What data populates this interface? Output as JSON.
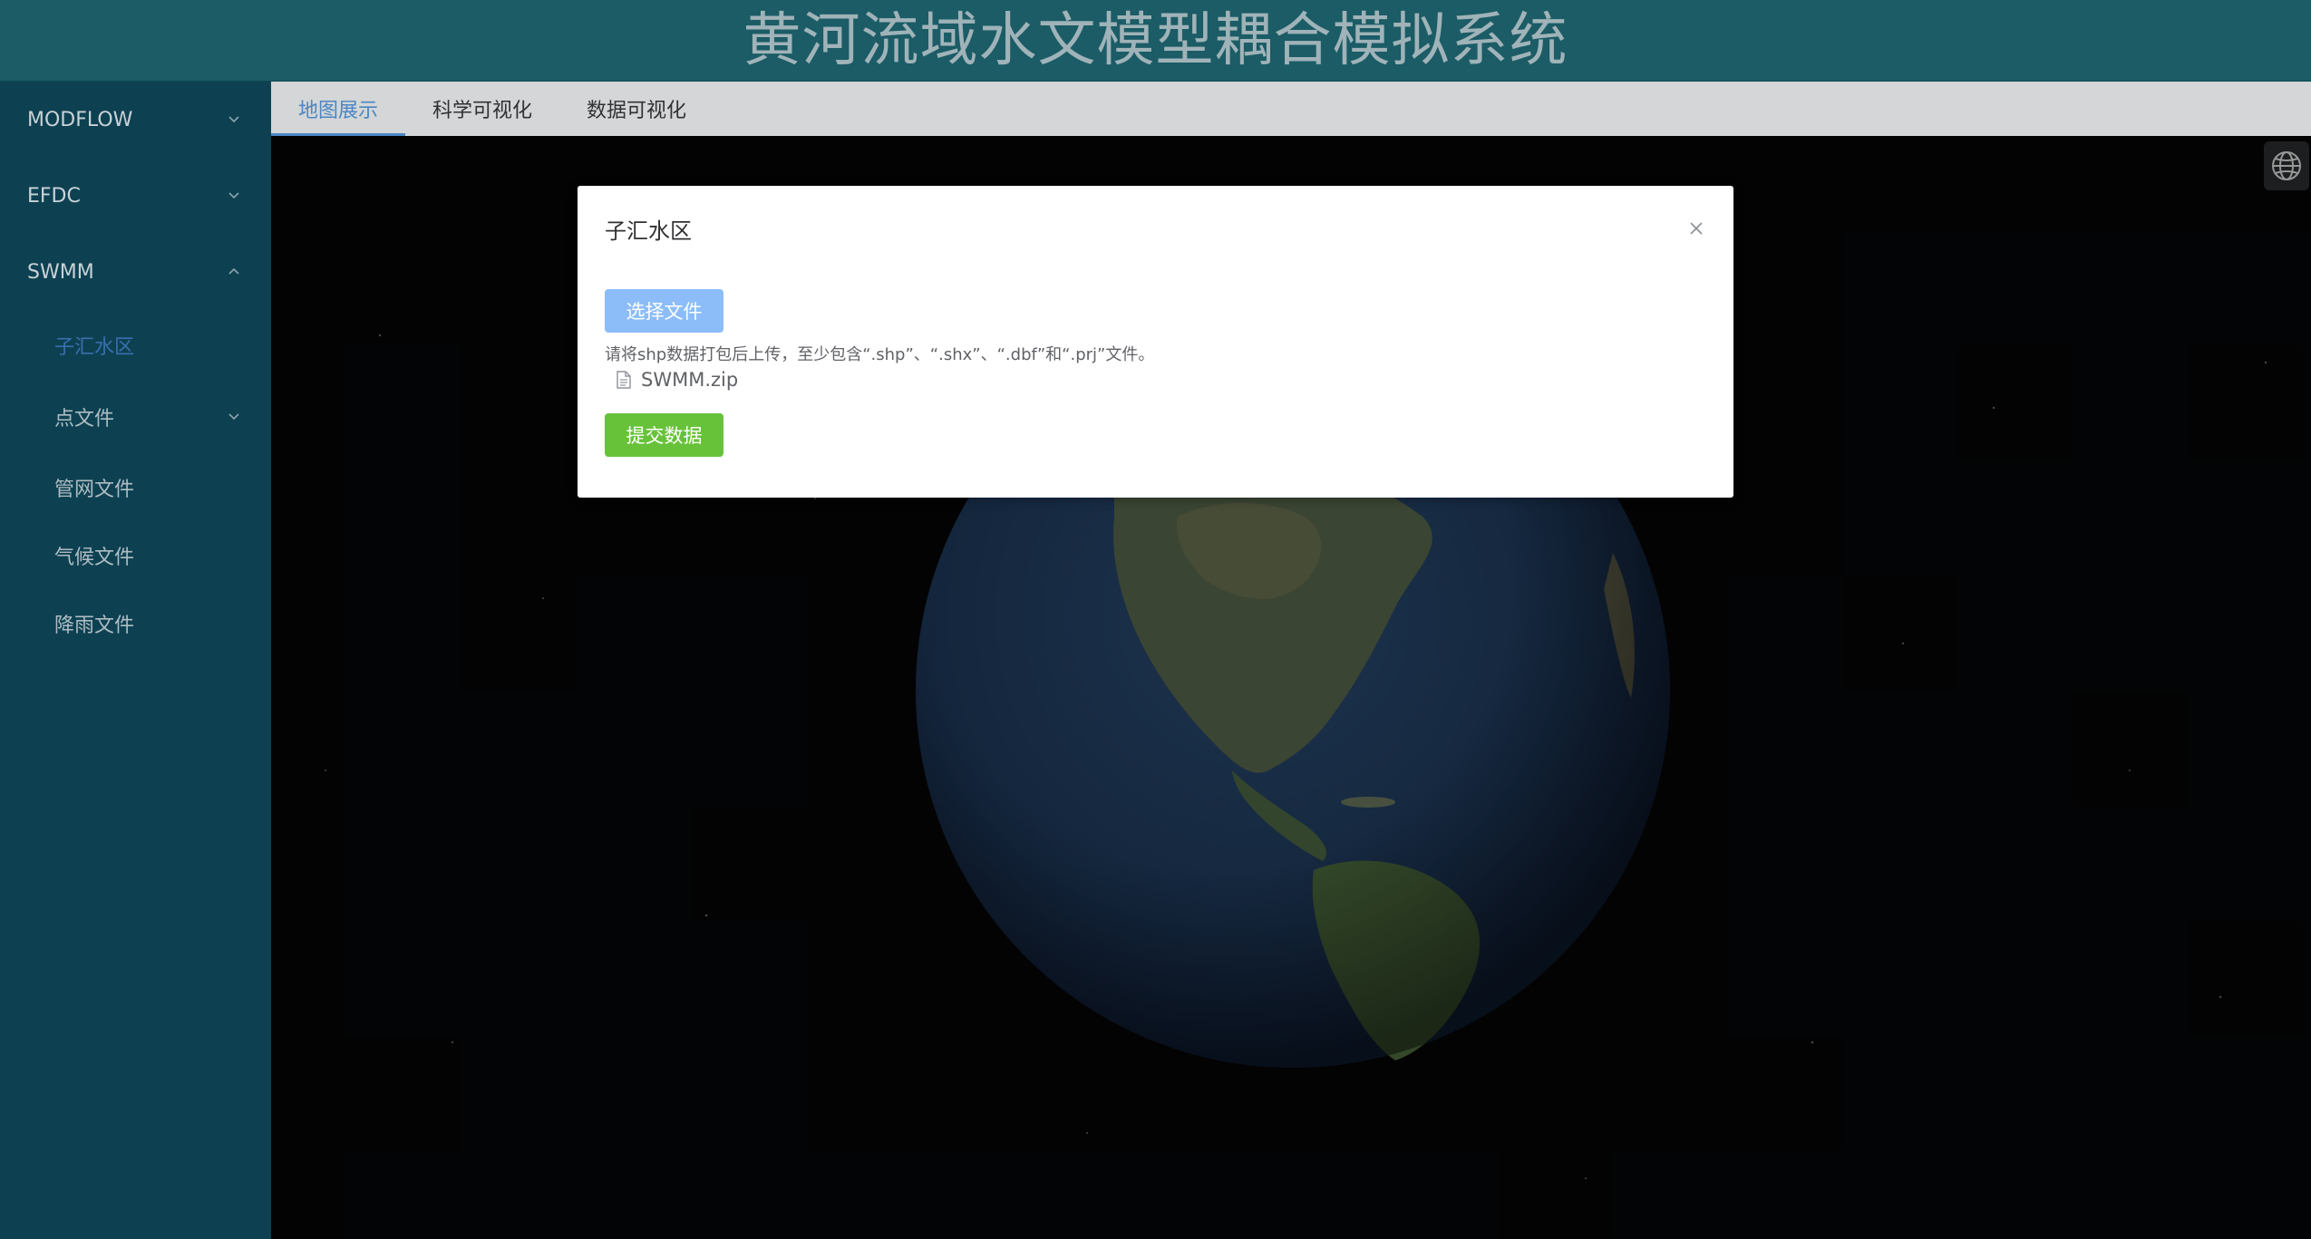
{
  "header": {
    "title": "黄河流域水文模型耦合模拟系统"
  },
  "sidebar": {
    "menus": [
      {
        "label": "MODFLOW",
        "expanded": false
      },
      {
        "label": "EFDC",
        "expanded": false
      },
      {
        "label": "SWMM",
        "expanded": true
      }
    ],
    "swmm_items": [
      {
        "label": "子汇水区",
        "active": true
      },
      {
        "label": "点文件",
        "has_children": true
      },
      {
        "label": "管网文件"
      },
      {
        "label": "气候文件"
      },
      {
        "label": "降雨文件"
      }
    ]
  },
  "tabs": [
    {
      "label": "地图展示",
      "active": true
    },
    {
      "label": "科学可视化"
    },
    {
      "label": "数据可视化"
    }
  ],
  "map": {
    "globe_button_icon": "globe-icon"
  },
  "dialog": {
    "title": "子汇水区",
    "select_button": "选择文件",
    "tip": "请将shp数据打包后上传，至少包含“.shp”、“.shx”、“.dbf”和“.prj”文件。",
    "file_name": "SWMM.zip",
    "submit_button": "提交数据"
  },
  "colors": {
    "header_bg": "#1b5c66",
    "sidebar_bg": "#0d4152",
    "active_accent": "#4b87c4",
    "submit_green": "#67c23a",
    "select_blue": "#8cbdf8"
  }
}
